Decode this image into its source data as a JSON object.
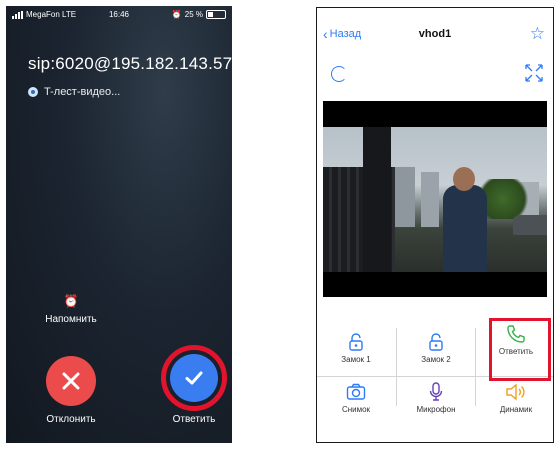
{
  "left_screen": {
    "status_bar": {
      "carrier": "MegaFon  LTE",
      "time": "16:46",
      "battery": "25 %"
    },
    "caller": "sip:6020@195.182.143.57",
    "app_name": "T-лест-видео...",
    "remind_label": "Напомнить",
    "decline_label": "Отклонить",
    "accept_label": "Ответить"
  },
  "right_screen": {
    "nav": {
      "back_label": "Назад",
      "title": "vhod1"
    },
    "controls": {
      "lock1": "Замок 1",
      "lock2": "Замок 2",
      "answer": "Ответить",
      "snapshot": "Снимок",
      "mic": "Микрофон",
      "speaker": "Динамик"
    }
  },
  "colors": {
    "accent": "#2d7bf5",
    "answer_green": "#34b24a",
    "speaker_orange": "#f0a020",
    "mic_purple": "#6a3fb8",
    "decline_red": "#ec4b4b",
    "accept_blue": "#3a7df0",
    "highlight": "#e2142d"
  }
}
